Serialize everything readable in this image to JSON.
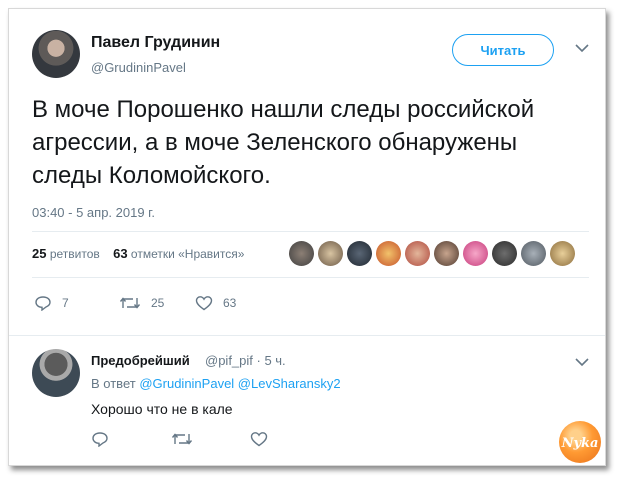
{
  "tweet": {
    "author_name": "Павел Грудинин",
    "author_handle": "@GrudininPavel",
    "follow_label": "Читать",
    "text": "В моче Порошенко нашли следы российской агрессии, а в моче Зеленского обнаружены следы Коломойского.",
    "timestamp": "03:40 - 5 апр. 2019 г.",
    "retweets_count": "25",
    "retweets_label": "ретвитов",
    "likes_count": "63",
    "likes_label": "отметки «Нравится»",
    "actions": {
      "reply": "7",
      "retweet": "25",
      "like": "63"
    }
  },
  "reply": {
    "author_name": "Предобрейший",
    "author_handle": "@pif_pif · 5 ч.",
    "reply_to_prefix": "В ответ",
    "reply_to_users": "@GrudininPavel @LevSharansky2",
    "text": "Хорошо что не в кале"
  },
  "watermark": {
    "text": "Nyka",
    "color": "#f08a24"
  },
  "colors": {
    "accent": "#1da1f2",
    "secondary_text": "#657786",
    "primary_text": "#14171a"
  },
  "icons": {
    "reply": "reply-icon",
    "retweet": "retweet-icon",
    "like": "heart-icon",
    "more": "chevron-down-icon"
  }
}
